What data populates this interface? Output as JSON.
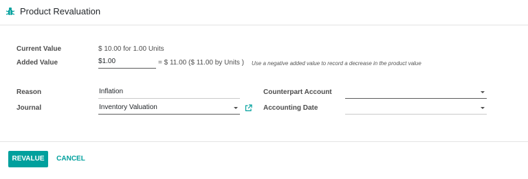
{
  "dialog": {
    "title": "Product Revaluation"
  },
  "form": {
    "current_value_label": "Current Value",
    "current_value": "$ 10.00 for 1.00 Units",
    "added_value_label": "Added Value",
    "added_value_currency": "$",
    "added_value_amount": "1.00",
    "added_value_result": "= $ 11.00 ($ 11.00 by  Units )",
    "added_value_hint": "Use a negative added value to record a decrease in the product value",
    "reason_label": "Reason",
    "reason_value": "Inflation",
    "journal_label": "Journal",
    "journal_value": "Inventory Valuation",
    "counterpart_account_label": "Counterpart Account",
    "counterpart_account_value": "",
    "accounting_date_label": "Accounting Date",
    "accounting_date_value": ""
  },
  "footer": {
    "revalue_label": "REVALUE",
    "cancel_label": "CANCEL"
  },
  "colors": {
    "accent": "#00a09d",
    "field_border": "#c9c9c9",
    "text": "#4c4c4c"
  },
  "icons": {
    "title_icon": "bug-icon",
    "journal_link_icon": "external-link-icon"
  }
}
